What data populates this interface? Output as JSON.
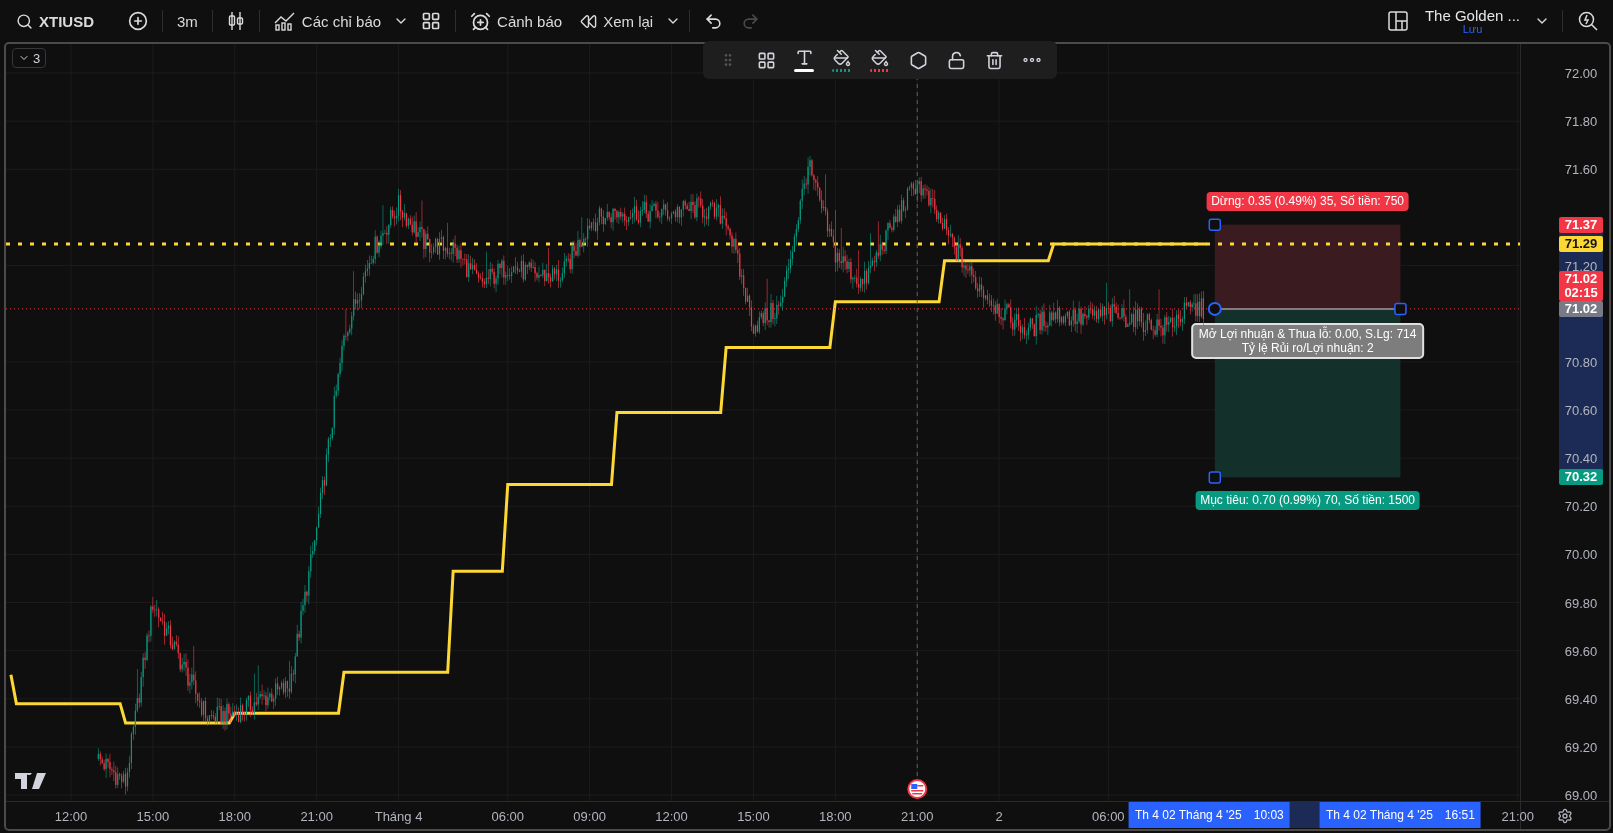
{
  "toolbar": {
    "symbol": "XTIUSD",
    "interval": "3m",
    "indicators": "Các chỉ báo",
    "alerts": "Cảnh báo",
    "replay": "Xem lại",
    "redo": {
      "disabled": true
    },
    "layout_name": "The Golden ...",
    "save_state": "Lưu"
  },
  "pane": {
    "count": "3"
  },
  "chart": {
    "chart_data": {
      "type": "line",
      "grid": true,
      "categories": [
        null,
        null,
        null,
        null,
        null,
        null,
        null,
        null,
        null,
        null,
        null,
        "12:00",
        null,
        null,
        null,
        null,
        null,
        null,
        null,
        null,
        null,
        null,
        null,
        null,
        null,
        null,
        "15:00",
        null,
        null,
        null,
        null,
        null,
        null,
        null,
        null,
        null,
        null,
        null,
        null,
        null,
        null,
        "18:00",
        null,
        null,
        null,
        null,
        null,
        null,
        null,
        null,
        null,
        null,
        null,
        null,
        null,
        null,
        "21:00",
        null,
        null,
        null,
        null,
        null,
        null,
        null,
        null,
        null,
        null,
        null,
        null,
        null,
        null,
        "Tháng 4",
        null,
        null,
        null,
        null,
        null,
        null,
        null,
        null,
        null,
        null,
        null,
        null,
        null,
        null,
        null,
        null,
        null,
        null,
        null,
        "06:00",
        null,
        null,
        null,
        null,
        null,
        null,
        null,
        null,
        null,
        null,
        null,
        null,
        null,
        null,
        "09:00",
        null,
        null,
        null,
        null,
        null,
        null,
        null,
        null,
        null,
        null,
        null,
        null,
        null,
        null,
        "12:00",
        null,
        null,
        null,
        null,
        null,
        null,
        null,
        null,
        null,
        null,
        null,
        null,
        null,
        null,
        "15:00",
        null,
        null,
        null,
        null,
        null,
        null,
        null,
        null,
        null,
        null,
        null,
        null,
        null,
        null,
        "18:00",
        null,
        null,
        null,
        null,
        null,
        null,
        null,
        null,
        null,
        null,
        null,
        null,
        null,
        null,
        "21:00",
        null,
        null,
        null,
        null,
        null,
        null,
        null,
        null,
        null,
        null,
        null,
        null,
        null,
        null,
        "2",
        null,
        null,
        null,
        null,
        null,
        null,
        null,
        null,
        null,
        null,
        null,
        null,
        null,
        null,
        null,
        null,
        null,
        null,
        null,
        "06:00",
        null,
        null,
        null,
        null,
        null,
        null,
        null,
        null,
        null,
        null,
        null,
        null,
        null,
        null,
        null,
        null,
        null,
        null,
        null,
        null,
        null,
        null,
        null,
        null,
        null,
        null,
        null,
        null,
        null,
        null,
        null,
        null,
        null,
        null,
        null,
        null,
        null,
        null,
        null,
        null,
        null,
        null,
        null,
        null,
        null,
        null,
        null,
        null,
        null,
        null,
        null,
        null,
        null,
        null,
        null,
        null,
        null,
        null,
        null,
        null,
        null,
        null,
        null,
        null,
        null,
        null,
        null,
        null,
        null,
        null,
        null,
        null,
        null,
        null,
        "21:00"
      ],
      "series": [
        {
          "color": "#fdd835",
          "values": [
            69.5,
            69.38,
            69.38,
            69.38,
            69.38,
            69.38,
            69.38,
            69.38,
            69.38,
            69.38,
            69.38,
            69.38,
            69.38,
            69.38,
            69.38,
            69.38,
            69.38,
            69.38,
            69.38,
            69.38,
            69.38,
            69.3,
            69.3,
            69.3,
            69.3,
            69.3,
            69.3,
            69.3,
            69.3,
            69.3,
            69.3,
            69.3,
            69.3,
            69.3,
            69.3,
            69.3,
            69.3,
            69.3,
            69.3,
            69.3,
            69.3,
            69.34,
            69.34,
            69.34,
            69.34,
            69.34,
            69.34,
            69.34,
            69.34,
            69.34,
            69.34,
            69.34,
            69.34,
            69.34,
            69.34,
            69.34,
            69.34,
            69.34,
            69.34,
            69.34,
            69.34,
            69.51,
            69.51,
            69.51,
            69.51,
            69.51,
            69.51,
            69.51,
            69.51,
            69.51,
            69.51,
            69.51,
            69.51,
            69.51,
            69.51,
            69.51,
            69.51,
            69.51,
            69.51,
            69.51,
            69.51,
            69.93,
            69.93,
            69.93,
            69.93,
            69.93,
            69.93,
            69.93,
            69.93,
            69.93,
            69.93,
            70.29,
            70.29,
            70.29,
            70.29,
            70.29,
            70.29,
            70.29,
            70.29,
            70.29,
            70.29,
            70.29,
            70.29,
            70.29,
            70.29,
            70.29,
            70.29,
            70.29,
            70.29,
            70.29,
            70.29,
            70.59,
            70.59,
            70.59,
            70.59,
            70.59,
            70.59,
            70.59,
            70.59,
            70.59,
            70.59,
            70.59,
            70.59,
            70.59,
            70.59,
            70.59,
            70.59,
            70.59,
            70.59,
            70.59,
            70.59,
            70.86,
            70.86,
            70.86,
            70.86,
            70.86,
            70.86,
            70.86,
            70.86,
            70.86,
            70.86,
            70.86,
            70.86,
            70.86,
            70.86,
            70.86,
            70.86,
            70.86,
            70.86,
            70.86,
            70.86,
            71.05,
            71.05,
            71.05,
            71.05,
            71.05,
            71.05,
            71.05,
            71.05,
            71.05,
            71.05,
            71.05,
            71.05,
            71.05,
            71.05,
            71.05,
            71.05,
            71.05,
            71.05,
            71.05,
            71.05,
            71.22,
            71.22,
            71.22,
            71.22,
            71.22,
            71.22,
            71.22,
            71.22,
            71.22,
            71.22,
            71.22,
            71.22,
            71.22,
            71.22,
            71.22,
            71.22,
            71.22,
            71.22,
            71.22,
            71.22,
            71.29,
            71.29,
            71.29,
            71.29,
            71.29,
            71.29,
            71.29,
            71.29,
            71.29,
            71.29,
            71.29,
            71.29,
            71.29,
            71.29,
            71.29,
            71.29,
            71.29,
            71.29,
            71.29,
            71.29,
            71.29,
            71.29,
            71.29,
            71.29,
            71.29,
            71.29,
            71.29,
            71.29,
            71.29,
            null,
            null,
            null,
            null,
            null,
            null,
            null,
            null,
            null,
            null,
            null,
            null,
            null,
            null,
            null,
            null,
            null,
            null,
            null,
            null,
            null,
            null,
            null,
            null,
            null,
            null,
            null,
            null,
            null,
            null,
            null,
            null,
            null,
            null,
            null,
            null,
            null,
            null,
            null,
            null,
            null,
            null,
            null,
            null,
            null,
            null,
            null,
            null,
            null,
            null,
            null,
            null,
            null,
            null,
            null,
            null,
            null
          ]
        }
      ],
      "ylim": [
        68.9755,
        72.1205
      ],
      "yticks": [
        {
          "value": 72,
          "label": "72.00"
        },
        {
          "value": 71.8,
          "label": "71.80"
        },
        {
          "value": 71.6,
          "label": "71.60"
        },
        {
          "value": 71.2,
          "label": "71.20"
        },
        {
          "value": 70.8,
          "label": "70.80"
        },
        {
          "value": 70.6,
          "label": "70.60"
        },
        {
          "value": 70.4,
          "label": "70.40"
        },
        {
          "value": 70.2,
          "label": "70.20"
        },
        {
          "value": 70,
          "label": "70.00"
        },
        {
          "value": 69.8,
          "label": "69.80"
        },
        {
          "value": 69.6,
          "label": "69.60"
        },
        {
          "value": 69.4,
          "label": "69.40"
        },
        {
          "value": 69.2,
          "label": "69.20"
        },
        {
          "value": 69,
          "label": "69.00"
        }
      ],
      "ref_lines": [
        {
          "axis": "y",
          "value": 71.29,
          "color": "#fdd835"
        },
        {
          "axis": "y",
          "value": 71.02,
          "color": "#f23645"
        }
      ],
      "bands": [
        {
          "axis": "y",
          "from": 71.02,
          "to": 71.37,
          "color": "#3a1b1f"
        },
        {
          "axis": "y",
          "from": 70.32,
          "to": 71.02,
          "color": "#13302a"
        }
      ],
      "annotations": [
        "Dừng: 0.35 (0.49%) 35, Số tiền: 750",
        "Mở Lợi nhuận & Thua lỗ: 0.00, S.Lg: 714",
        "Tỷ lệ Rủi ro/Lợi nhuận: 2",
        "Mục tiêu: 0.70 (0.99%) 70, Số tiền: 1500"
      ]
    },
    "price_badges": [
      {
        "label": "71.37",
        "color": "#f23645"
      },
      {
        "label": "71.29",
        "color": "#fdd835"
      },
      {
        "label": "71.02",
        "sub_label": "02:15",
        "color": "#f23645"
      },
      {
        "label": "71.02",
        "color": "#787b86"
      },
      {
        "label": "70.32",
        "color": "#089981"
      }
    ],
    "time_badges": [
      {
        "date": "Th 4 02 Tháng 4 '25",
        "time": "10:03"
      },
      {
        "date": "Th 4 02 Tháng 4 '25",
        "time": "16:51"
      }
    ]
  }
}
